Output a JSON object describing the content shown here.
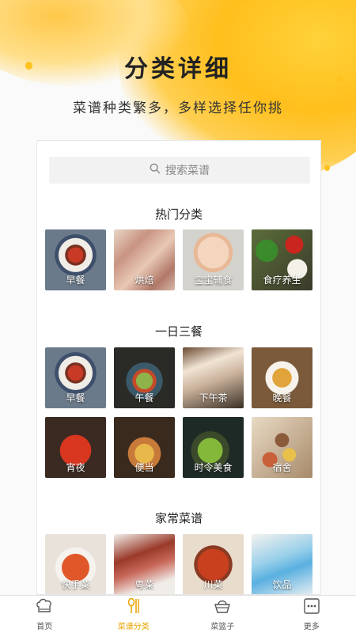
{
  "hero": {
    "title": "分类详细",
    "subtitle": "菜谱种类繁多，多样选择任你挑"
  },
  "search": {
    "icon": "search-icon",
    "placeholder": "搜索菜谱"
  },
  "sections": [
    {
      "title": "热门分类",
      "items": [
        {
          "label": "早餐",
          "thumb": "t-zao"
        },
        {
          "label": "烘焙",
          "thumb": "t-hong"
        },
        {
          "label": "宝宝辅食",
          "thumb": "t-bao"
        },
        {
          "label": "食疗养生",
          "thumb": "t-shi"
        }
      ]
    },
    {
      "title": "一日三餐",
      "items": [
        {
          "label": "早餐",
          "thumb": "t-zao"
        },
        {
          "label": "午餐",
          "thumb": "t-wu"
        },
        {
          "label": "下午茶",
          "thumb": "t-xia"
        },
        {
          "label": "晚餐",
          "thumb": "t-wan"
        },
        {
          "label": "宵夜",
          "thumb": "t-ye"
        },
        {
          "label": "便当",
          "thumb": "t-bian"
        },
        {
          "label": "时令美食",
          "thumb": "t-shiling"
        },
        {
          "label": "宿舍",
          "thumb": "t-qi"
        }
      ]
    },
    {
      "title": "家常菜谱",
      "items": [
        {
          "label": "快手菜",
          "thumb": "t-kuai"
        },
        {
          "label": "粤菜",
          "thumb": "t-yue"
        },
        {
          "label": "川菜",
          "thumb": "t-chuan"
        },
        {
          "label": "饮品",
          "thumb": "t-yin"
        }
      ]
    }
  ],
  "tabbar": {
    "active_color": "#e8a400",
    "tabs": [
      {
        "label": "首页",
        "icon": "chef-hat-icon",
        "active": false
      },
      {
        "label": "菜谱分类",
        "icon": "spoon-fork-icon",
        "active": true
      },
      {
        "label": "菜篮子",
        "icon": "basket-icon",
        "active": false
      },
      {
        "label": "更多",
        "icon": "more-icon",
        "active": false
      }
    ]
  }
}
